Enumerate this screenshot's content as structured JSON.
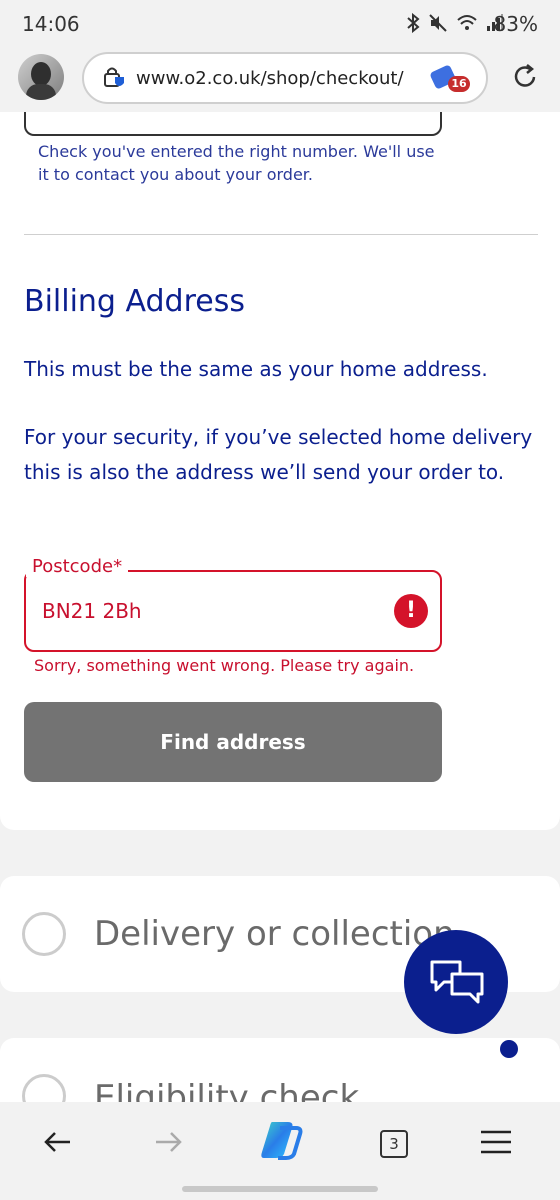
{
  "status_bar": {
    "time": "14:06",
    "battery": "83%"
  },
  "browser": {
    "url": "www.o2.co.uk/shop/checkout/",
    "tag_badge": "16",
    "tab_count": "3"
  },
  "phone_section": {
    "help_text": "Check you've entered the right number. We'll use it to contact you about your order."
  },
  "billing": {
    "title": "Billing Address",
    "text1": "This must be the same as your home address.",
    "text2": "For your security, if you’ve selected home delivery this is also the address we’ll send your order to.",
    "postcode_label": "Postcode*",
    "postcode_value": "BN21 2Bh",
    "error_icon": "!",
    "error_text": "Sorry, something went wrong. Please try again.",
    "find_button": "Find address"
  },
  "steps": {
    "delivery_label": "Delivery or collection",
    "eligibility_label": "Eligibility check"
  },
  "colors": {
    "brand_navy": "#0b1f8e",
    "error_red": "#d4132a",
    "disabled_grey": "#737373"
  },
  "icons": {
    "chat": "chat-bubbles-icon",
    "back": "back-arrow-icon",
    "forward": "forward-arrow-icon",
    "copilot": "copilot-icon",
    "menu": "menu-icon",
    "reload": "reload-icon",
    "shield": "shield-icon"
  }
}
